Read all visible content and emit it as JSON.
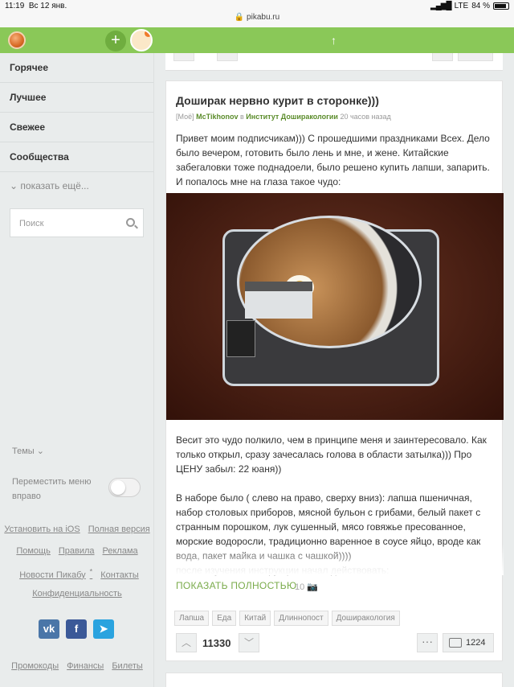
{
  "status": {
    "time": "11:19",
    "date": "Вс 12 янв.",
    "network": "LTE",
    "battery": "84 %"
  },
  "url": "pikabu.ru",
  "nav": [
    "Горячее",
    "Лучшее",
    "Свежее",
    "Сообщества"
  ],
  "show_more": "показать ещё...",
  "search_placeholder": "Поиск",
  "themes": "Темы",
  "move_right": "Переместить меню вправо",
  "links": {
    "install_ios": "Установить на iOS",
    "full_version": "Полная версия",
    "help": "Помощь",
    "rules": "Правила",
    "ads": "Реклама",
    "news": "Новости Пикабу",
    "news_star": "*",
    "contacts": "Контакты",
    "privacy": "Конфиденциальность",
    "promo": "Промокоды",
    "finance": "Финансы",
    "tickets": "Билеты"
  },
  "social": {
    "vk": "vk",
    "fb": "f",
    "tg": "➤"
  },
  "post": {
    "title": "Доширак нервно курит в сторонке)))",
    "meta_prefix": "[Моё]",
    "author": "McTikhonov",
    "in": "в",
    "community": "Институт Доширакологии",
    "time": "20 часов назад",
    "text1": "Привет моим подписчикам))) С прошедшими праздниками Всех. Дело было вечером, готовить было лень и мне, и жене. Китайские забегаловки тоже поднадоели, было решено купить лапши, запарить. И попалось мне на глаза такое чудо:",
    "text2": "Весит это чудо полкило, чем в принципе меня и заинтересовало. Как только открыл, сразу зачесалась голова в области затылка))) Про ЦЕНУ забыл: 22 юаня))",
    "text3": "В наборе было ( слево на право, сверху вниз): лапша пшеничная, набор столовых приборов, мясной бульон с грибами, белый пакет с странным порошком, лук сушенный, мясо говяжье пресованное, морские водоросли, традиционно варенное в соусе яйцо, вроде как вода, пакет майка и чашка с чашкой))))",
    "text4": "после изучения инструкции начал действовать:",
    "show_full": "ПОКАЗАТЬ ПОЛНОСТЬЮ",
    "image_count": "10",
    "tags": [
      "Лапша",
      "Еда",
      "Китай",
      "Длиннопост",
      "Доширакология"
    ],
    "rating": "11330",
    "comments": "1224"
  },
  "colors": {
    "accent": "#8ac858",
    "link": "#5b8c2b"
  }
}
